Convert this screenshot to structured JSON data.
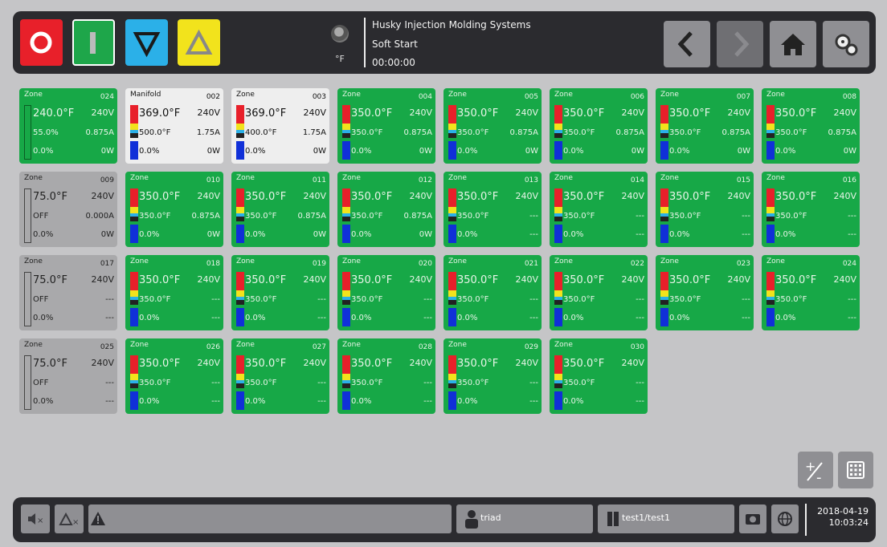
{
  "header": {
    "company": "Husky Injection Molding Systems",
    "mode": "Soft Start",
    "timer": "00:00:00",
    "unit": "°F"
  },
  "buttons": {
    "stop": "stop",
    "start": "start",
    "lower": "decrease",
    "raise": "increase"
  },
  "zones": [
    {
      "name": "Zone",
      "num": "024",
      "temp": "240.0°F",
      "volt": "240V",
      "sp": "55.0%",
      "amp": "0.875A",
      "pct": "0.0%",
      "watt": "0W",
      "style": "run-plain"
    },
    {
      "name": "Manifold",
      "num": "002",
      "temp": "369.0°F",
      "volt": "240V",
      "sp": "500.0°F",
      "amp": "1.75A",
      "pct": "0.0%",
      "watt": "0W",
      "style": "man"
    },
    {
      "name": "Zone",
      "num": "003",
      "temp": "369.0°F",
      "volt": "240V",
      "sp": "400.0°F",
      "amp": "1.75A",
      "pct": "0.0%",
      "watt": "0W",
      "style": "man"
    },
    {
      "name": "Zone",
      "num": "004",
      "temp": "350.0°F",
      "volt": "240V",
      "sp": "350.0°F",
      "amp": "0.875A",
      "pct": "0.0%",
      "watt": "0W",
      "style": "run"
    },
    {
      "name": "Zone",
      "num": "005",
      "temp": "350.0°F",
      "volt": "240V",
      "sp": "350.0°F",
      "amp": "0.875A",
      "pct": "0.0%",
      "watt": "0W",
      "style": "run"
    },
    {
      "name": "Zone",
      "num": "006",
      "temp": "350.0°F",
      "volt": "240V",
      "sp": "350.0°F",
      "amp": "0.875A",
      "pct": "0.0%",
      "watt": "0W",
      "style": "run"
    },
    {
      "name": "Zone",
      "num": "007",
      "temp": "350.0°F",
      "volt": "240V",
      "sp": "350.0°F",
      "amp": "0.875A",
      "pct": "0.0%",
      "watt": "0W",
      "style": "run"
    },
    {
      "name": "Zone",
      "num": "008",
      "temp": "350.0°F",
      "volt": "240V",
      "sp": "350.0°F",
      "amp": "0.875A",
      "pct": "0.0%",
      "watt": "0W",
      "style": "run"
    },
    {
      "name": "Zone",
      "num": "009",
      "temp": "75.0°F",
      "volt": "240V",
      "sp": "OFF",
      "amp": "0.000A",
      "pct": "0.0%",
      "watt": "0W",
      "style": "off"
    },
    {
      "name": "Zone",
      "num": "010",
      "temp": "350.0°F",
      "volt": "240V",
      "sp": "350.0°F",
      "amp": "0.875A",
      "pct": "0.0%",
      "watt": "0W",
      "style": "run"
    },
    {
      "name": "Zone",
      "num": "011",
      "temp": "350.0°F",
      "volt": "240V",
      "sp": "350.0°F",
      "amp": "0.875A",
      "pct": "0.0%",
      "watt": "0W",
      "style": "run"
    },
    {
      "name": "Zone",
      "num": "012",
      "temp": "350.0°F",
      "volt": "240V",
      "sp": "350.0°F",
      "amp": "0.875A",
      "pct": "0.0%",
      "watt": "0W",
      "style": "run"
    },
    {
      "name": "Zone",
      "num": "013",
      "temp": "350.0°F",
      "volt": "240V",
      "sp": "350.0°F",
      "amp": "---",
      "pct": "0.0%",
      "watt": "---",
      "style": "run"
    },
    {
      "name": "Zone",
      "num": "014",
      "temp": "350.0°F",
      "volt": "240V",
      "sp": "350.0°F",
      "amp": "---",
      "pct": "0.0%",
      "watt": "---",
      "style": "run"
    },
    {
      "name": "Zone",
      "num": "015",
      "temp": "350.0°F",
      "volt": "240V",
      "sp": "350.0°F",
      "amp": "---",
      "pct": "0.0%",
      "watt": "---",
      "style": "run"
    },
    {
      "name": "Zone",
      "num": "016",
      "temp": "350.0°F",
      "volt": "240V",
      "sp": "350.0°F",
      "amp": "---",
      "pct": "0.0%",
      "watt": "---",
      "style": "run"
    },
    {
      "name": "Zone",
      "num": "017",
      "temp": "75.0°F",
      "volt": "240V",
      "sp": "OFF",
      "amp": "---",
      "pct": "0.0%",
      "watt": "---",
      "style": "off"
    },
    {
      "name": "Zone",
      "num": "018",
      "temp": "350.0°F",
      "volt": "240V",
      "sp": "350.0°F",
      "amp": "---",
      "pct": "0.0%",
      "watt": "---",
      "style": "run"
    },
    {
      "name": "Zone",
      "num": "019",
      "temp": "350.0°F",
      "volt": "240V",
      "sp": "350.0°F",
      "amp": "---",
      "pct": "0.0%",
      "watt": "---",
      "style": "run"
    },
    {
      "name": "Zone",
      "num": "020",
      "temp": "350.0°F",
      "volt": "240V",
      "sp": "350.0°F",
      "amp": "---",
      "pct": "0.0%",
      "watt": "---",
      "style": "run"
    },
    {
      "name": "Zone",
      "num": "021",
      "temp": "350.0°F",
      "volt": "240V",
      "sp": "350.0°F",
      "amp": "---",
      "pct": "0.0%",
      "watt": "---",
      "style": "run"
    },
    {
      "name": "Zone",
      "num": "022",
      "temp": "350.0°F",
      "volt": "240V",
      "sp": "350.0°F",
      "amp": "---",
      "pct": "0.0%",
      "watt": "---",
      "style": "run"
    },
    {
      "name": "Zone",
      "num": "023",
      "temp": "350.0°F",
      "volt": "240V",
      "sp": "350.0°F",
      "amp": "---",
      "pct": "0.0%",
      "watt": "---",
      "style": "run"
    },
    {
      "name": "Zone",
      "num": "024",
      "temp": "350.0°F",
      "volt": "240V",
      "sp": "350.0°F",
      "amp": "---",
      "pct": "0.0%",
      "watt": "---",
      "style": "run"
    },
    {
      "name": "Zone",
      "num": "025",
      "temp": "75.0°F",
      "volt": "240V",
      "sp": "OFF",
      "amp": "---",
      "pct": "0.0%",
      "watt": "---",
      "style": "off"
    },
    {
      "name": "Zone",
      "num": "026",
      "temp": "350.0°F",
      "volt": "240V",
      "sp": "350.0°F",
      "amp": "---",
      "pct": "0.0%",
      "watt": "---",
      "style": "run"
    },
    {
      "name": "Zone",
      "num": "027",
      "temp": "350.0°F",
      "volt": "240V",
      "sp": "350.0°F",
      "amp": "---",
      "pct": "0.0%",
      "watt": "---",
      "style": "run"
    },
    {
      "name": "Zone",
      "num": "028",
      "temp": "350.0°F",
      "volt": "240V",
      "sp": "350.0°F",
      "amp": "---",
      "pct": "0.0%",
      "watt": "---",
      "style": "run"
    },
    {
      "name": "Zone",
      "num": "029",
      "temp": "350.0°F",
      "volt": "240V",
      "sp": "350.0°F",
      "amp": "---",
      "pct": "0.0%",
      "watt": "---",
      "style": "run"
    },
    {
      "name": "Zone",
      "num": "030",
      "temp": "350.0°F",
      "volt": "240V",
      "sp": "350.0°F",
      "amp": "---",
      "pct": "0.0%",
      "watt": "---",
      "style": "run"
    }
  ],
  "footer": {
    "user": "triad",
    "mold": "test1/test1",
    "date": "2018-04-19",
    "time": "10:03:24"
  },
  "colors": {
    "run": "#17a847",
    "off": "#a9a9ab",
    "manifold": "#eeeeee",
    "stop": "#e8202a",
    "start": "#1ea64a",
    "lower": "#2bb0e8",
    "raise": "#f2e31c"
  }
}
